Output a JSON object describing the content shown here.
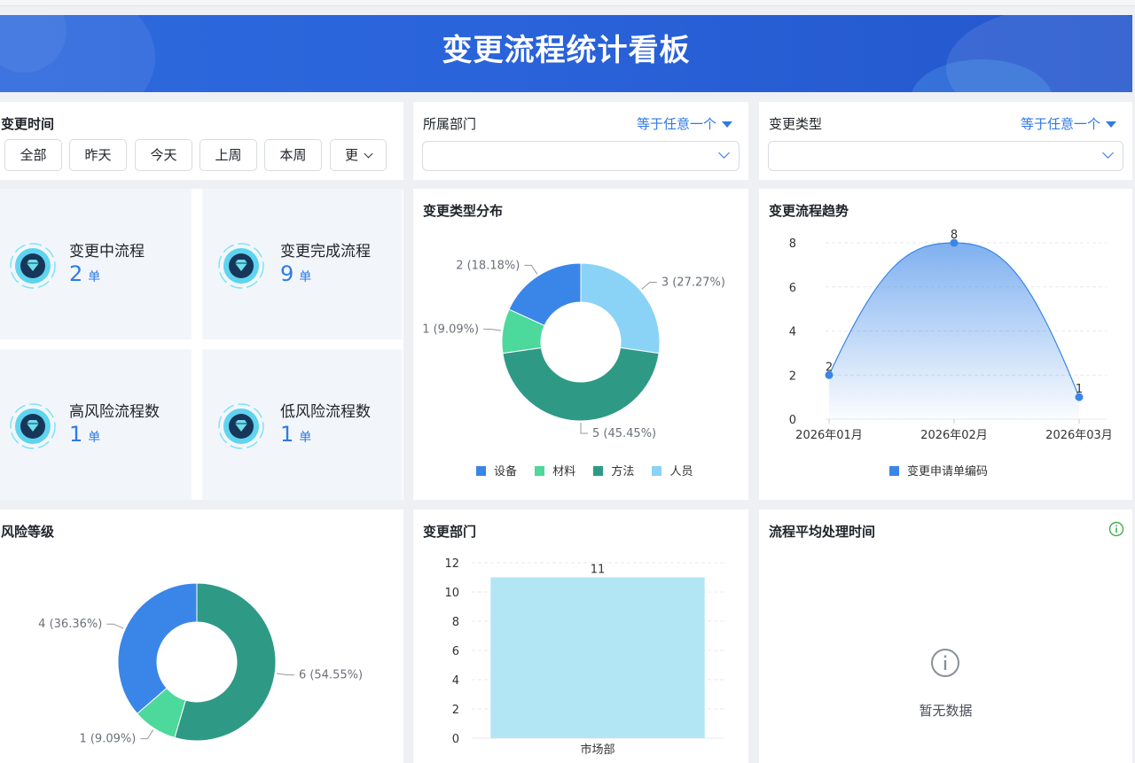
{
  "banner": {
    "title": "变更流程统计看板"
  },
  "filters": {
    "time": {
      "label": "变更时间",
      "buttons": [
        "全部",
        "昨天",
        "今天",
        "上周",
        "本周"
      ],
      "more_label": "更"
    },
    "department": {
      "label": "所属部门",
      "operator": "等于任意一个"
    },
    "change_type": {
      "label": "变更类型",
      "operator": "等于任意一个"
    }
  },
  "stats": [
    {
      "label": "变更中流程",
      "value": "2",
      "unit": "单"
    },
    {
      "label": "变更完成流程",
      "value": "9",
      "unit": "单"
    },
    {
      "label": "高风险流程数",
      "value": "1",
      "unit": "单"
    },
    {
      "label": "低风险流程数",
      "value": "1",
      "unit": "单"
    }
  ],
  "panels": {
    "type_dist": {
      "title": "变更类型分布"
    },
    "trend": {
      "title": "变更流程趋势"
    },
    "risk": {
      "title": "风险等级"
    },
    "dept": {
      "title": "变更部门"
    },
    "avg_time": {
      "title": "流程平均处理时间",
      "empty_text": "暂无数据"
    }
  },
  "colors": {
    "accent": "#2f7ae5",
    "blue": "#3a86e8",
    "green": "#4dd89c",
    "teal": "#2e9a86",
    "light_blue": "#8ad3f7",
    "bar": "#b3e6f4"
  },
  "chart_data": [
    {
      "type": "pie",
      "title": "变更类型分布",
      "categories": [
        "设备",
        "材料",
        "方法",
        "人员"
      ],
      "values": [
        2,
        1,
        5,
        3
      ],
      "labels": [
        "2 (18.18%)",
        "1 (9.09%)",
        "5 (45.45%)",
        "3 (27.27%)"
      ],
      "legend": "bottom"
    },
    {
      "type": "area",
      "title": "变更流程趋势",
      "x": [
        "2026年01月",
        "2026年02月",
        "2026年03月"
      ],
      "series": [
        {
          "name": "变更申请单编码",
          "values": [
            2,
            8,
            1
          ]
        }
      ],
      "ylim": [
        0,
        8
      ],
      "yticks": [
        "0",
        "2",
        "4",
        "6",
        "8"
      ],
      "legend": "bottom"
    },
    {
      "type": "pie",
      "title": "风险等级",
      "values": [
        6,
        1,
        4
      ],
      "labels": [
        "6 (54.55%)",
        "1 (9.09%)",
        "4 (36.36%)"
      ]
    },
    {
      "type": "bar",
      "title": "变更部门",
      "categories": [
        "市场部"
      ],
      "values": [
        11
      ],
      "ylim": [
        0,
        12
      ],
      "yticks": [
        "0",
        "2",
        "4",
        "6",
        "8",
        "10",
        "12"
      ]
    }
  ]
}
